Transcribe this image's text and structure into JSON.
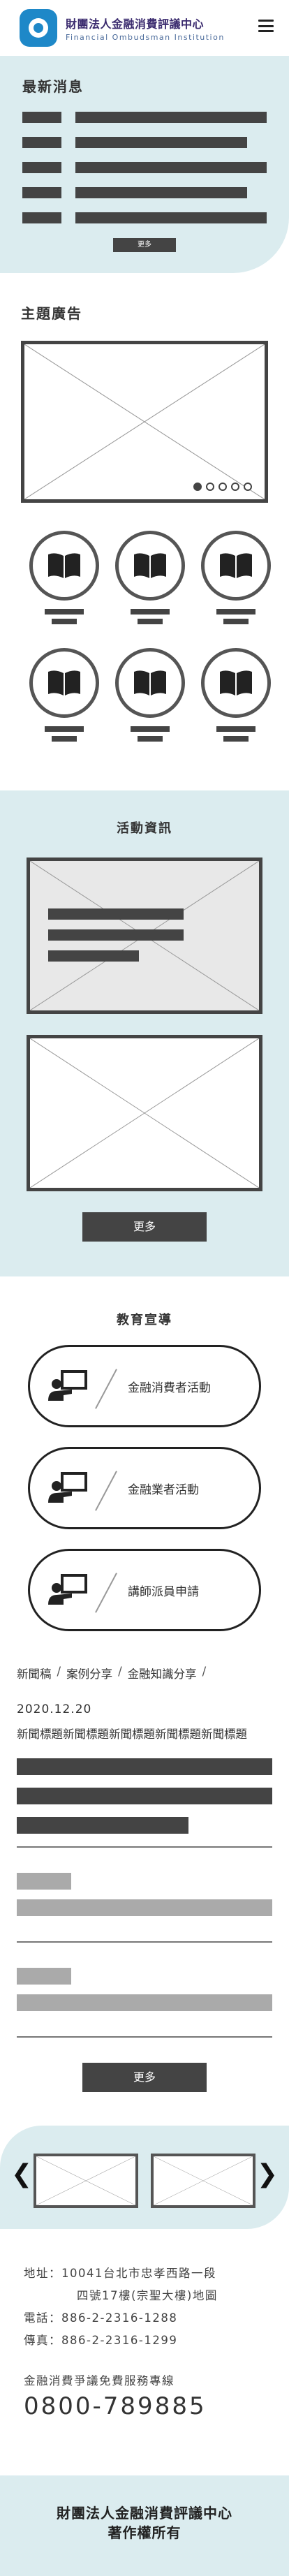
{
  "header": {
    "logo_cn": "財團法人金融消費評議中心",
    "logo_en": "Financial Ombudsman Institution"
  },
  "news": {
    "title": "最新消息",
    "more_label": "更多"
  },
  "ads": {
    "title": "主題廣告",
    "slide_count": 5,
    "active_slide": 1
  },
  "activity": {
    "title": "活動資訊",
    "more_label": "更多"
  },
  "education": {
    "title": "教育宣導",
    "buttons": [
      "金融消費者活動",
      "金融業者活動",
      "講師派員申請"
    ]
  },
  "tabs": [
    "新聞稿",
    "案例分享",
    "金融知識分享"
  ],
  "article": {
    "date": "2020.12.20",
    "title": "新聞標題新聞標題新聞標題新聞標題新聞標題",
    "more_label": "更多"
  },
  "footer": {
    "address_label": "地址：",
    "address_line1": "10041台北市忠孝西路一段",
    "address_line2": "四號17樓(宗聖大樓)地圖",
    "phone": "電話：886-2-2316-1288",
    "fax": "傳真：886-2-2316-1299",
    "hotline_label": "金融消費爭議免費服務專線",
    "hotline_number": "0800-789885",
    "org_name": "財團法人金融消費評議中心",
    "copyright": "著作權所有"
  }
}
